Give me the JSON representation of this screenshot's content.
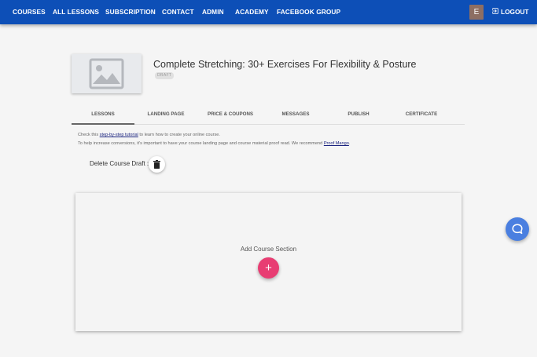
{
  "nav": {
    "items": [
      {
        "label": "COURSES"
      },
      {
        "label": "ALL LESSONS"
      },
      {
        "label": "SUBSCRIPTION"
      },
      {
        "label": "CONTACT"
      },
      {
        "label": "ADMIN"
      },
      {
        "label": "ACADEMY"
      },
      {
        "label": "FACEBOOK GROUP"
      }
    ],
    "avatar_initial": "E",
    "logout_label": "LOGOUT"
  },
  "course": {
    "title": "Complete Stretching: 30+ Exercises For Flexibility & Posture",
    "status_badge": "DRAFT",
    "thumbnail_icon": "image-placeholder-icon"
  },
  "tabs": [
    {
      "label": "LESSONS",
      "active": true
    },
    {
      "label": "LANDING PAGE",
      "active": false
    },
    {
      "label": "PRICE & COUPONS",
      "active": false
    },
    {
      "label": "MESSAGES",
      "active": false
    },
    {
      "label": "PUBLISH",
      "active": false
    },
    {
      "label": "CERTIFICATE",
      "active": false
    }
  ],
  "info": {
    "line1_prefix": "Check this ",
    "line1_link": "step-by-step tutorial",
    "line1_suffix": " to learn how to create your online course.",
    "line2_prefix": "To help increase conversions, it's important to have your course landing page and course material proof read. We recommend ",
    "line2_link": "Proof Mango",
    "line2_suffix": "."
  },
  "delete_draft": {
    "label": "Delete Course Draft :",
    "icon": "trash-icon"
  },
  "section": {
    "add_label": "Add Course Section",
    "add_button_glyph": "+"
  },
  "colors": {
    "navbar": "#0d4fb7",
    "add_button": "#e83e73",
    "chat_button": "#4a7fe0",
    "avatar": "#8d6e63"
  }
}
